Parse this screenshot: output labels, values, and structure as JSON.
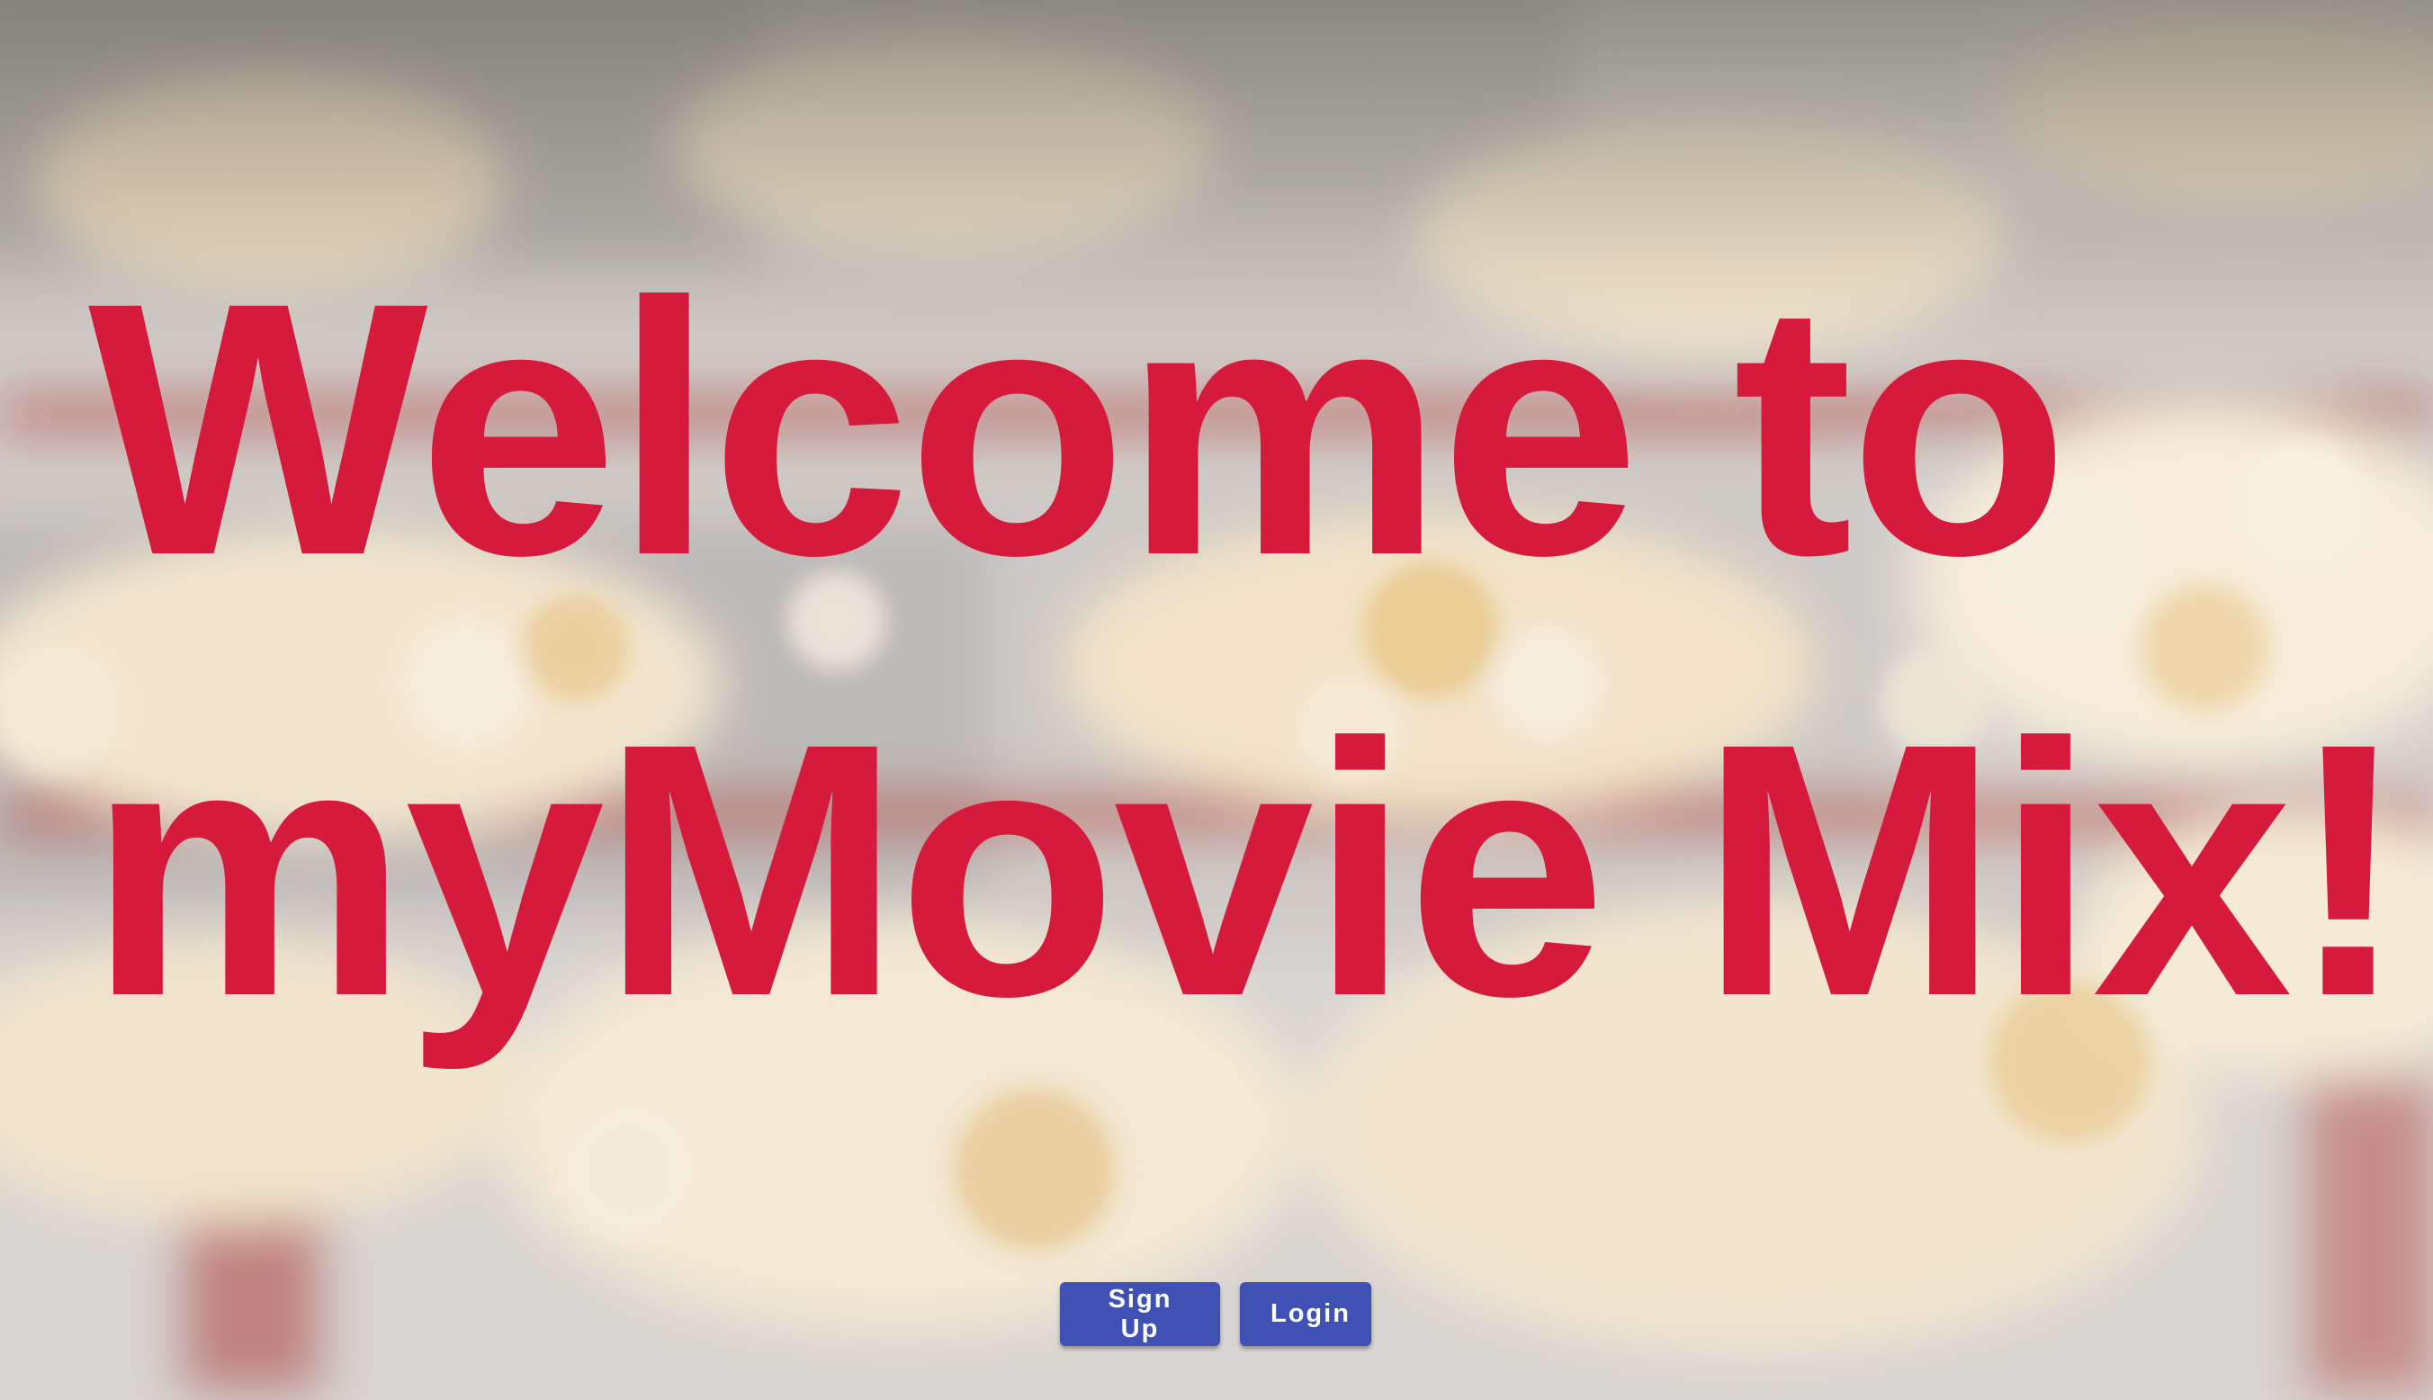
{
  "page": {
    "headline_line1": "Welcome to",
    "headline_line2": "myMovie Mix!",
    "headline_color": "#d51a3c",
    "background_image": "popcorn-boxes-photo"
  },
  "actions": {
    "signup_label": "Sign Up",
    "login_label": "Login",
    "button_color": "#3f51b5"
  }
}
